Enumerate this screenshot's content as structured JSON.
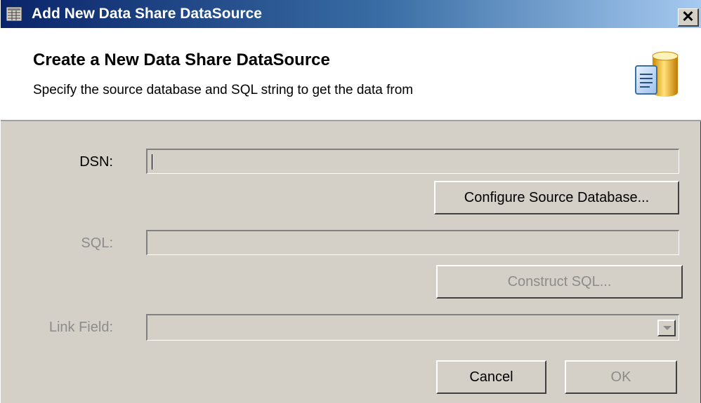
{
  "window": {
    "title": "Add New Data Share DataSource",
    "close_glyph": "✕"
  },
  "header": {
    "title": "Create a New Data Share DataSource",
    "subtitle": "Specify the source database and SQL string to get the data from",
    "icon": "database-document-icon"
  },
  "form": {
    "dsn": {
      "label": "DSN:",
      "value": "",
      "enabled": true
    },
    "configure_button": "Configure Source Database...",
    "sql": {
      "label": "SQL:",
      "value": "",
      "enabled": false
    },
    "construct_button": "Construct SQL...",
    "link_field": {
      "label": "Link Field:",
      "selected": "",
      "enabled": false
    }
  },
  "buttons": {
    "cancel": "Cancel",
    "ok": "OK"
  },
  "colors": {
    "dialog_bg": "#d4d0c8",
    "title_gradient_start": "#0a246a",
    "title_gradient_end": "#a6caf0",
    "disabled_text": "#8c8c8c"
  }
}
